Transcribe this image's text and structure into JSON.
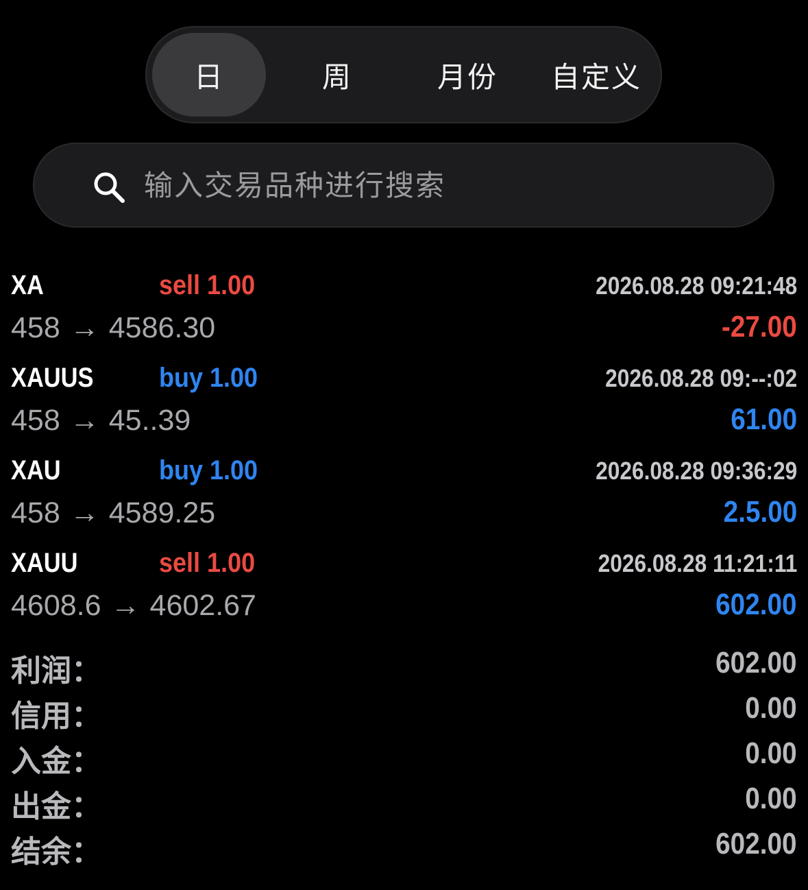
{
  "period_tabs": {
    "items": [
      {
        "label": "日",
        "active": true
      },
      {
        "label": "周",
        "active": false
      },
      {
        "label": "月份",
        "active": false
      },
      {
        "label": "自定义",
        "active": false
      }
    ]
  },
  "search": {
    "placeholder": "输入交易品种进行搜索",
    "value": ""
  },
  "trades": [
    {
      "symbol": "XA",
      "side": "sell 1.00",
      "time": "2026.08.28 09:21:48",
      "open_price": "458",
      "arrow": "→",
      "close_price": "4586.30",
      "profit": "-27.00"
    },
    {
      "symbol": "XAUUS",
      "side": "buy 1.00",
      "time": "2026.08.28 09:--:02",
      "open_price": "458",
      "arrow": "→",
      "close_price": "45..39",
      "profit": "61.00"
    },
    {
      "symbol": "XAU",
      "side": "buy 1.00",
      "time": "2026.08.28 09:36:29",
      "open_price": "458",
      "arrow": "→",
      "close_price": "4589.25",
      "profit": "2.5.00"
    },
    {
      "symbol": "XAUU",
      "side": "sell 1.00",
      "time": "2026.08.28 11:21:11",
      "open_price": "4608.6",
      "arrow": "→",
      "close_price": "4602.67",
      "profit": "602.00"
    }
  ],
  "summary": [
    {
      "label": "利润：",
      "value": "602.00"
    },
    {
      "label": "信用：",
      "value": "0.00"
    },
    {
      "label": "入金：",
      "value": "0.00"
    },
    {
      "label": "出金：",
      "value": "0.00"
    },
    {
      "label": "结余：",
      "value": "602.00"
    }
  ],
  "colors": {
    "background": "#000000",
    "sell": "#ea4a42",
    "buy": "#2f85f0",
    "loss": "#ea4a42",
    "gain": "#2f85f0",
    "muted": "#a9a9ad"
  }
}
